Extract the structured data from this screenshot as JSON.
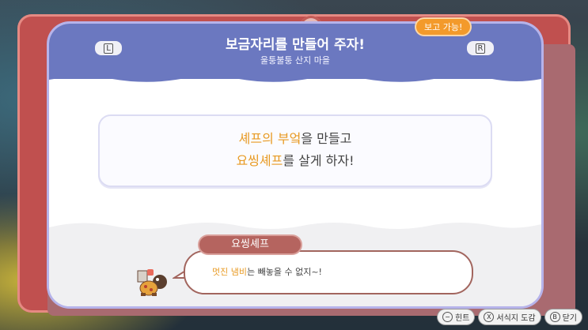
{
  "header": {
    "title": "보금자리를 만들어 주자!",
    "subtitle": "울퉁불퉁 산지 마을",
    "left_key": "L",
    "right_key": "R",
    "badge": "보고 가능!"
  },
  "goal": {
    "line1_highlight": "셰프의 부엌",
    "line1_rest": "을 만들고",
    "line2_highlight": "요씽셰프",
    "line2_rest": "를 살게 하자!"
  },
  "dialogue": {
    "speaker": "요씽셰프",
    "highlight": "멋진 냄비",
    "rest": "는 빼놓을 수 없지~!"
  },
  "hints": [
    {
      "icon": "−",
      "label": "힌트"
    },
    {
      "icon": "X",
      "label": "서식지 도감"
    },
    {
      "icon": "B",
      "label": "닫기"
    }
  ],
  "colors": {
    "frame": "#c0504f",
    "header_blue": "#6b78c0",
    "accent_orange": "#f39a2b",
    "highlight_text": "#e89a23"
  }
}
